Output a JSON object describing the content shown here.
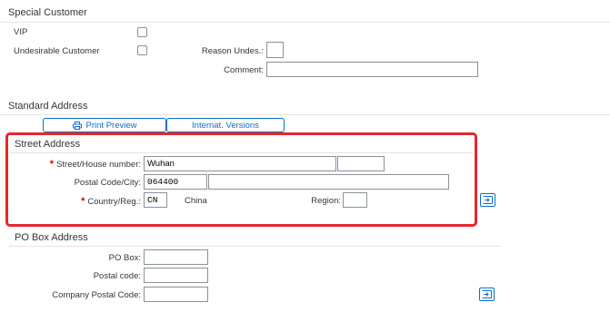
{
  "special_customer": {
    "title": "Special Customer",
    "vip_label": "VIP",
    "undesirable_label": "Undesirable Customer",
    "reason_label": "Reason Undes.:",
    "reason_value": "",
    "comment_label": "Comment:",
    "comment_value": ""
  },
  "standard_address": {
    "title": "Standard Address",
    "print_preview_label": "Print Preview",
    "internat_versions_label": "Internat. Versions"
  },
  "street_address": {
    "title": "Street Address",
    "street_label": "Street/House number:",
    "street_value": "Wuhan",
    "house_number_value": "",
    "postal_city_label": "Postal Code/City:",
    "postal_code_value": "064400",
    "city_value": "",
    "country_label": "Country/Reg.:",
    "country_value": "CN",
    "country_name": "China",
    "region_label": "Region:",
    "region_value": "",
    "highlight_color": "#e8262a"
  },
  "po_box_address": {
    "title": "PO Box Address",
    "po_box_label": "PO Box:",
    "po_box_value": "",
    "postal_code_label": "Postal code:",
    "postal_code_value": "",
    "company_postal_code_label": "Company Postal Code:",
    "company_postal_code_value": ""
  },
  "colors": {
    "accent": "#0a6ed1",
    "required": "#e00000"
  },
  "icons": {
    "print": "printer-icon",
    "expand": "expand-icon"
  }
}
